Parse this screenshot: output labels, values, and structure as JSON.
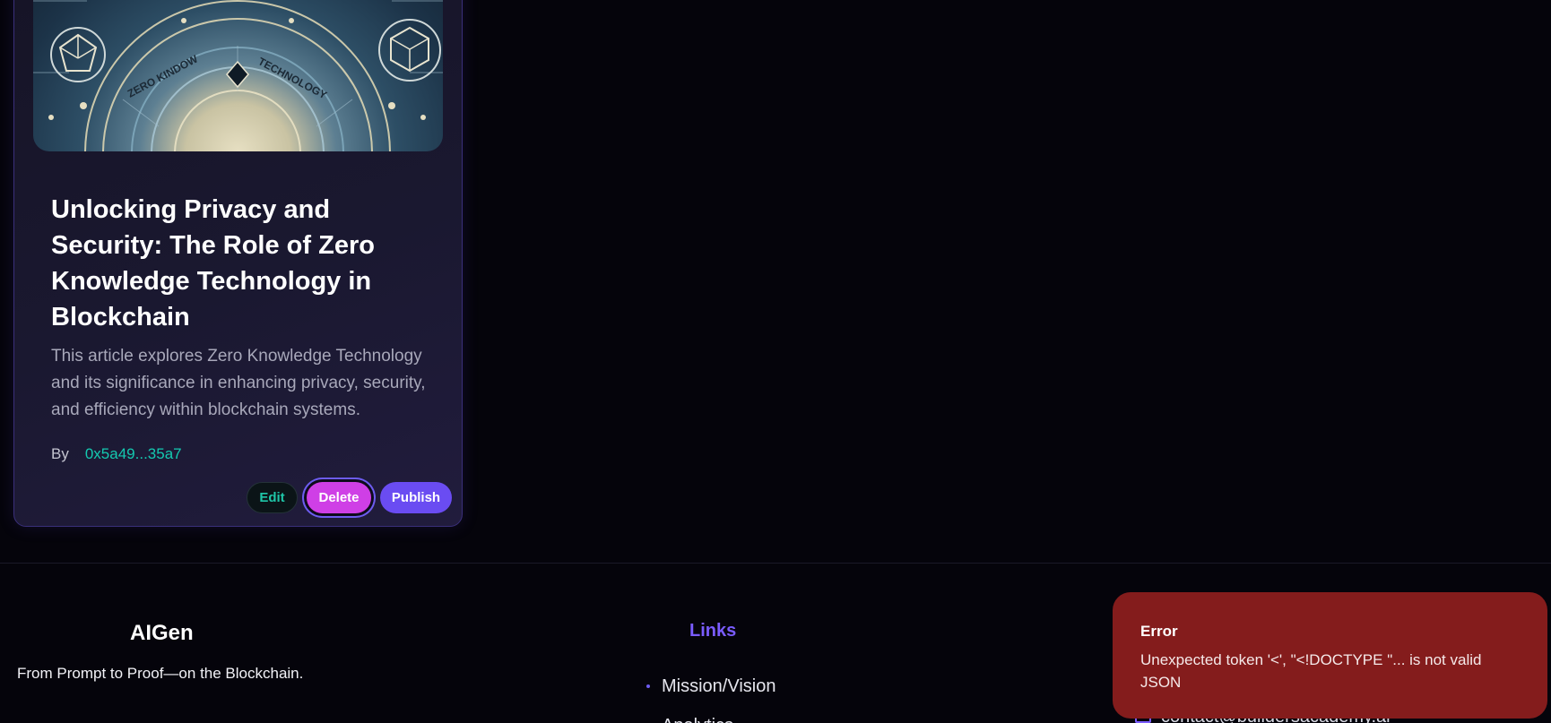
{
  "card": {
    "image_alt": "Zero Knowledge Technology illustration",
    "image_text_left": "ZERO KINDOW",
    "image_text_right": "TECHNOLOGY",
    "title": "Unlocking Privacy and Security: The Role of Zero Knowledge Technology in Blockchain",
    "description": "This article explores Zero Knowledge Technology and its significance in enhancing privacy, security, and efficiency within blockchain systems.",
    "by_label": "By",
    "author": "0x5a49...35a7",
    "actions": {
      "edit": "Edit",
      "delete": "Delete",
      "publish": "Publish"
    }
  },
  "footer": {
    "brand": "AIGen",
    "tagline": "From Prompt to Proof—on the Blockchain.",
    "links_title": "Links",
    "links": [
      "Mission/Vision",
      "Analytics"
    ],
    "contact_email": "contact@buildersacademy.ai"
  },
  "toast": {
    "title": "Error",
    "message": "Unexpected token '<', \"<!DOCTYPE \"... is not valid JSON"
  },
  "colors": {
    "background": "#05040b",
    "accent_purple": "#6a4cf2",
    "accent_teal": "#14c9b0",
    "delete_pink": "#cf3fe6",
    "error_red": "#841c1c"
  }
}
